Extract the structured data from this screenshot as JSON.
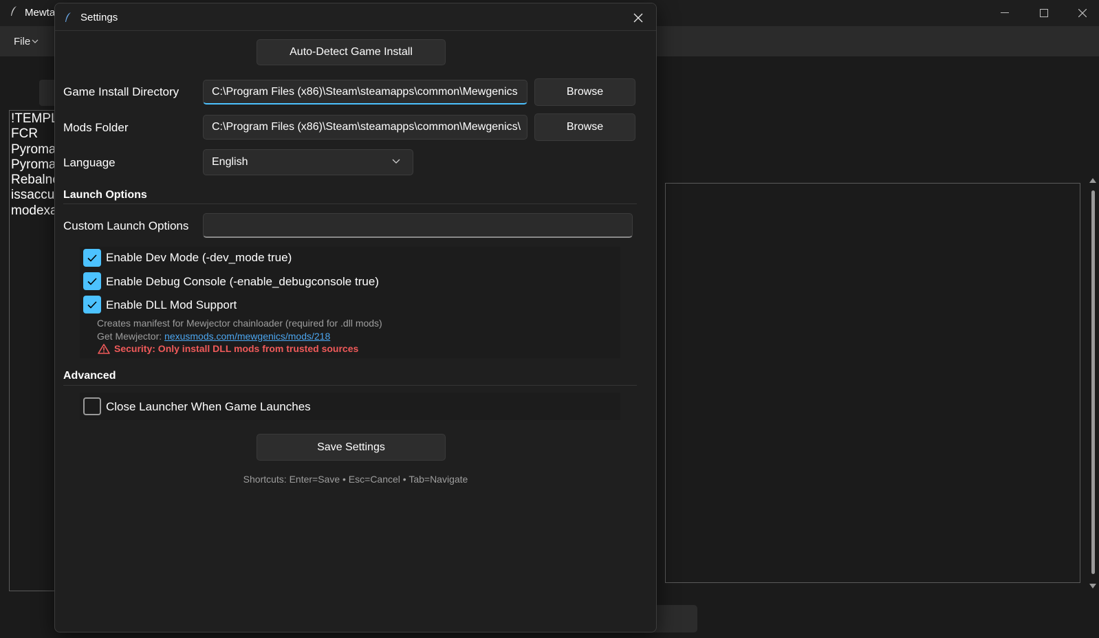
{
  "main_window": {
    "title": "Mewta",
    "menu": {
      "file_label": "File"
    },
    "mod_list": [
      "!TEMPL",
      "FCR",
      "Pyroma",
      "Pyroma",
      "Rebalnc",
      "issaccu",
      "modexa"
    ]
  },
  "dialog": {
    "title": "Settings",
    "auto_detect_label": "Auto-Detect Game Install",
    "game_install": {
      "label": "Game Install Directory",
      "value": "C:\\Program Files (x86)\\Steam\\steamapps\\common\\Mewgenics",
      "browse_label": "Browse"
    },
    "mods_folder": {
      "label": "Mods Folder",
      "value": "C:\\Program Files (x86)\\Steam\\steamapps\\common\\Mewgenics\\",
      "browse_label": "Browse"
    },
    "language": {
      "label": "Language",
      "value": "English"
    },
    "launch_options": {
      "section_title": "Launch Options",
      "custom_label": "Custom Launch Options",
      "custom_value": "",
      "checkboxes": [
        {
          "label": "Enable Dev Mode (-dev_mode true)",
          "checked": true
        },
        {
          "label": "Enable Debug Console (-enable_debugconsole true)",
          "checked": true
        },
        {
          "label": "Enable DLL Mod Support",
          "checked": true
        }
      ],
      "dll_note": "Creates manifest for Mewjector chainloader (required for .dll mods)",
      "get_prefix": "Get Mewjector: ",
      "get_link": "nexusmods.com/mewgenics/mods/218",
      "security_warning": "Security: Only install DLL mods from trusted sources"
    },
    "advanced": {
      "section_title": "Advanced",
      "checkboxes": [
        {
          "label": "Close Launcher When Game Launches",
          "checked": false
        }
      ]
    },
    "save_label": "Save Settings",
    "shortcuts": "Shortcuts: Enter=Save • Esc=Cancel • Tab=Navigate"
  },
  "colors": {
    "accent": "#4cc2ff",
    "link": "#4ca6f0",
    "warning": "#f05a5a",
    "background": "#1f1f1f"
  }
}
